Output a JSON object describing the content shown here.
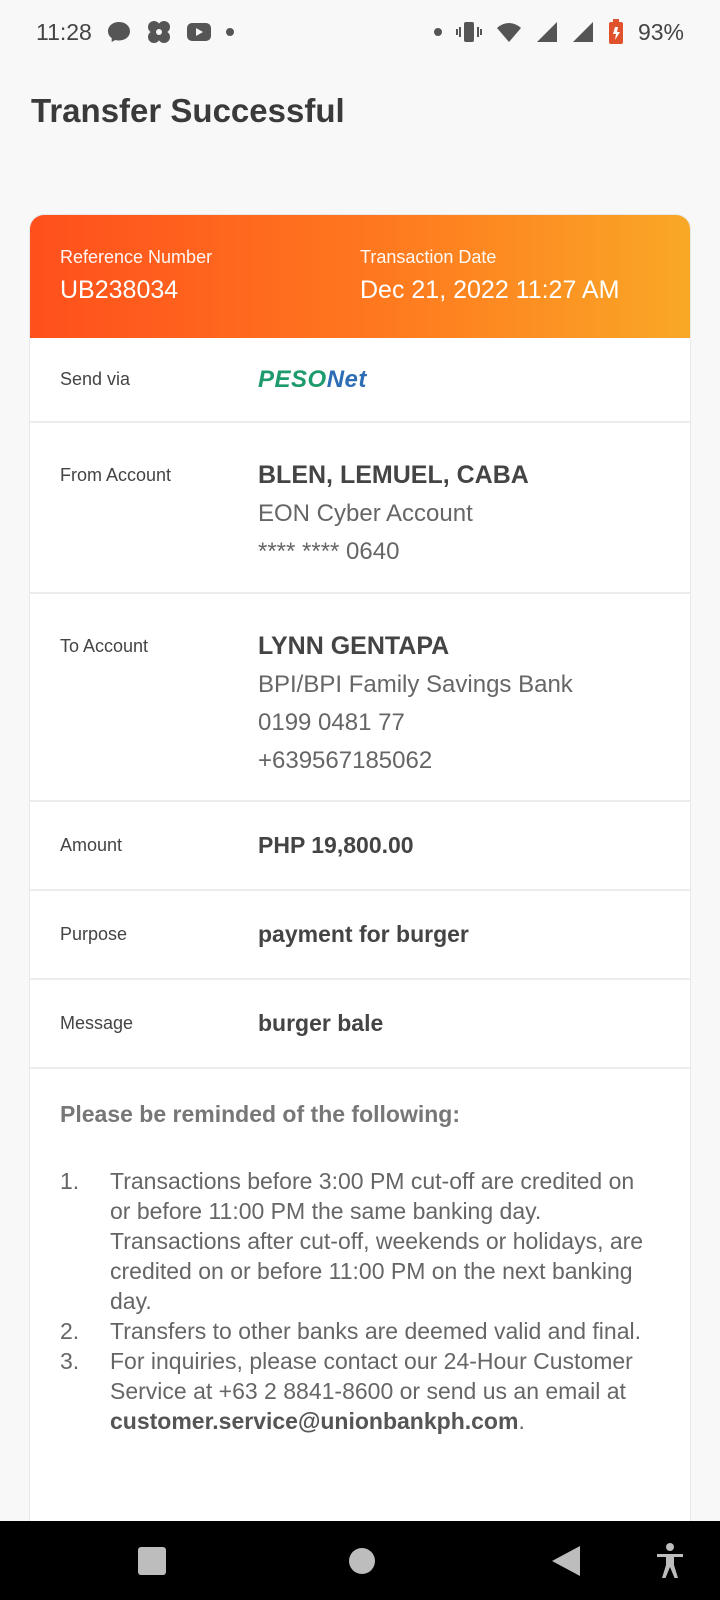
{
  "status_bar": {
    "time": "11:28",
    "battery_percent": "93%",
    "icons_left": [
      "messenger-icon",
      "pinwheel-icon",
      "youtube-icon",
      "dot-icon"
    ],
    "icons_right": [
      "dot-icon",
      "vibrate-icon",
      "wifi-icon",
      "signal-icon",
      "signal-icon",
      "battery-icon"
    ]
  },
  "page": {
    "title": "Transfer Successful"
  },
  "receipt": {
    "reference_label": "Reference Number",
    "reference_value": "UB238034",
    "date_label": "Transaction Date",
    "date_value": "Dec 21, 2022 11:27 AM",
    "send_via_label": "Send via",
    "send_via_logo_part1": "PESO",
    "send_via_logo_part2": "Net",
    "from_label": "From Account",
    "from_name": "BLEN, LEMUEL, CABA",
    "from_account_type": "EON Cyber Account",
    "from_account_number": "**** **** 0640",
    "to_label": "To Account",
    "to_name": "LYNN GENTAPA",
    "to_bank": "BPI/BPI Family Savings Bank",
    "to_account_number": "0199 0481 77",
    "to_phone": "+639567185062",
    "amount_label": "Amount",
    "amount_value": "PHP 19,800.00",
    "purpose_label": "Purpose",
    "purpose_value": "payment for burger",
    "message_label": "Message",
    "message_value": "burger bale"
  },
  "reminders": {
    "title": "Please be reminded of the following:",
    "items": [
      {
        "num": "1.",
        "text": "Transactions before 3:00 PM cut-off are credited on or before 11:00 PM the same banking day. Transactions after cut-off, weekends or holidays, are credited on or before 11:00 PM on the next banking day."
      },
      {
        "num": "2.",
        "text": "Transfers to other banks are deemed valid and final."
      },
      {
        "num": "3.",
        "text": "For inquiries, please contact our 24-Hour Customer Service at +63 2 8841-8600 or send us an email at ",
        "email": "customer.service@unionbankph.com",
        "suffix": "."
      }
    ]
  },
  "colors": {
    "header_gradient_start": "#ff4f1c",
    "header_gradient_end": "#f9a826",
    "nav_bar": "#000000"
  }
}
